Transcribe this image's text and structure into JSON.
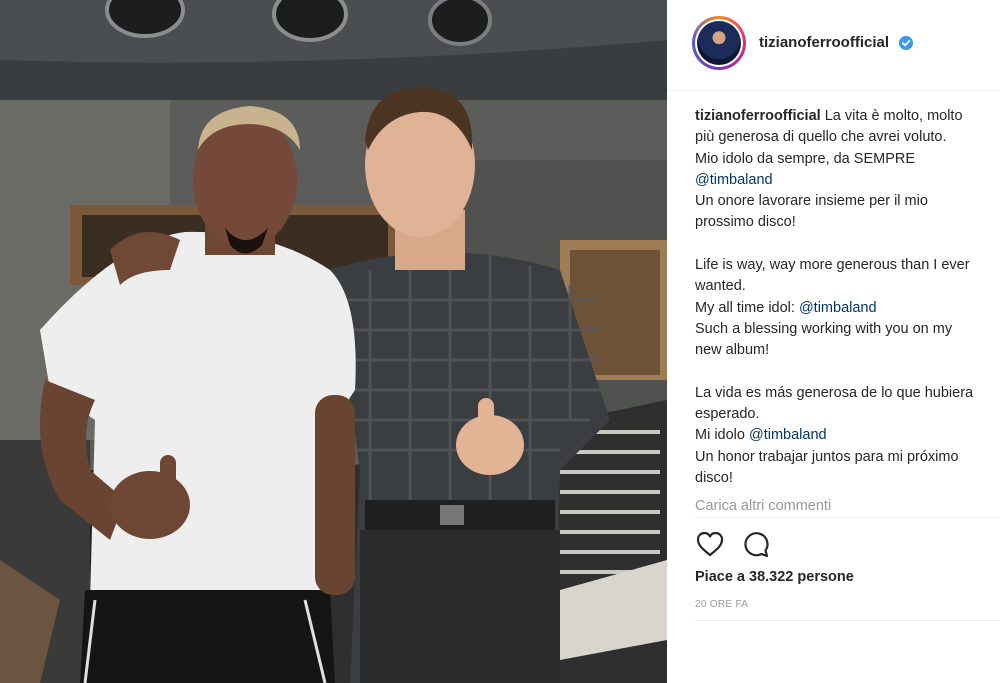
{
  "post": {
    "username": "tizianoferroofficial",
    "verified": true,
    "caption": {
      "username": "tizianoferroofficial",
      "segments": [
        {
          "type": "text",
          "value": " La vita è molto, molto\npiù generosa di quello che avrei voluto.\nMio idolo da sempre, da SEMPRE\n"
        },
        {
          "type": "mention",
          "value": "@timbaland"
        },
        {
          "type": "text",
          "value": "\nUn onore lavorare insieme per il mio\nprossimo disco!\n\nLife is way, way more generous than I ever\nwanted.\nMy all time idol: "
        },
        {
          "type": "mention",
          "value": "@timbaland"
        },
        {
          "type": "text",
          "value": "\nSuch a blessing working with you on my\nnew album!\n\nLa vida es más generosa de lo que hubiera\nesperado.\nMi idolo "
        },
        {
          "type": "mention",
          "value": "@timbaland"
        },
        {
          "type": "text",
          "value": "\nUn honor trabajar juntos para mi próximo\ndisco!"
        }
      ]
    },
    "load_more_label": "Carica altri commenti",
    "likes_label": "Piace a 38.322 persone",
    "time_label": "20 ORE FA",
    "actions": [
      {
        "name": "heart-icon",
        "label": "like"
      },
      {
        "name": "comment-icon",
        "label": "comment"
      }
    ]
  },
  "colors": {
    "text": "#262626",
    "secondary": "#999999",
    "mention": "#003569",
    "verified": "#3897f0",
    "border": "#efefef"
  }
}
